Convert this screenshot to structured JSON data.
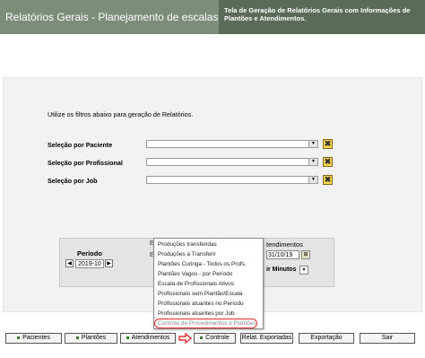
{
  "header": {
    "title": "Relatórios Gerais - Planejamento de escalas",
    "description": "Tela de Geração de Relatórios Gerais com Informações de Plantões e Atendimentos."
  },
  "filters": {
    "instruction": "Utilize os filtros abaixo para geração de Relatórios.",
    "paciente_label": "Seleção por Paciente",
    "profissional_label": "Seleção por Profissional",
    "job_label": "Seleção por Job",
    "paciente_value": "",
    "profissional_value": "",
    "job_value": ""
  },
  "periodo": {
    "label": "Período",
    "value": "2019-10"
  },
  "atendimentos": {
    "label": "tendimentos",
    "date": "31/10/19",
    "unit": "ir Minutos",
    "partial_letter_1": "E",
    "partial_letter_2": "E"
  },
  "menu": {
    "items": [
      "Produções transferidas",
      "Produções a Transferir",
      "Plantões Curinga - Todos os Profs.",
      "Plantões Vagos - por Período",
      "Escala de Profissionais Ativos",
      "Profissionais sem Plantão/Escala",
      "Profissionais atuantes no Período",
      "Profissionais atuantes por Job",
      "Controle de Procedimentos e Plantões"
    ]
  },
  "buttons": {
    "pacientes": "Pacientes",
    "plantoes": "Plantões",
    "atendimentos": "Atendimentos",
    "controle": "Controle",
    "relat_exportadas": "Relat. Exportadas",
    "exportacao": "Exportação",
    "sair": "Sair"
  },
  "icons": {
    "dropdown": "▼",
    "clear": "✖",
    "prev": "◀",
    "next": "▶",
    "date": "⊞"
  },
  "colors": {
    "header_left": "#7c8d79",
    "header_right": "#5a6b5a",
    "highlight_oval": "#e03030"
  }
}
